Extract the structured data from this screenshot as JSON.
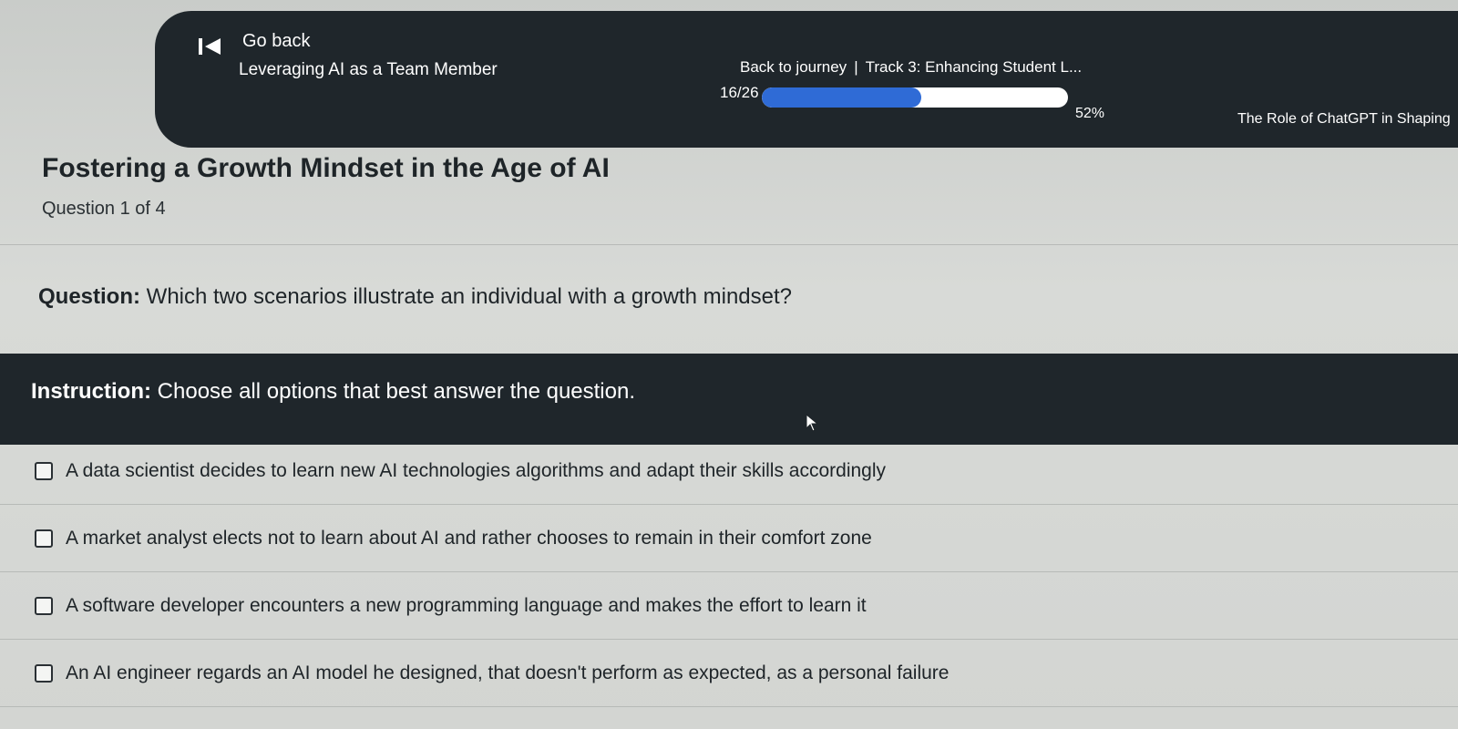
{
  "header": {
    "back_label": "Go back",
    "course_title": "Leveraging AI as a Team Member",
    "journey_link": "Back to journey",
    "separator": "|",
    "track_title": "Track 3: Enhancing Student L...",
    "lesson_count": "16/26",
    "progress_percent": "52%",
    "progress_value": 0.52,
    "next_lesson_title": "The Role of ChatGPT in Shaping"
  },
  "lesson": {
    "title": "Fostering a Growth Mindset in the Age of AI",
    "question_progress": "Question 1 of 4"
  },
  "question": {
    "label": "Question:",
    "text": "Which two scenarios illustrate an individual with a growth mindset?"
  },
  "instruction": {
    "label": "Instruction:",
    "text": "Choose all options that best answer the question."
  },
  "options": [
    {
      "text": "A data scientist decides to learn new AI technologies algorithms and adapt their skills accordingly",
      "checked": false
    },
    {
      "text": "A market analyst elects not to learn about AI and rather chooses to remain in their comfort zone",
      "checked": false
    },
    {
      "text": "A software developer encounters a new programming language and makes the effort to learn it",
      "checked": false
    },
    {
      "text": "An AI engineer regards an AI model he designed, that doesn't perform as expected, as a personal failure",
      "checked": false
    }
  ],
  "icons": {
    "back": "skip-back-icon",
    "cursor": "mouse-pointer-icon",
    "checkbox": "checkbox-icon"
  },
  "colors": {
    "header_bg": "#1f262b",
    "progress_fill": "#2f6bd6",
    "page_bg": "#d4d6d3"
  }
}
